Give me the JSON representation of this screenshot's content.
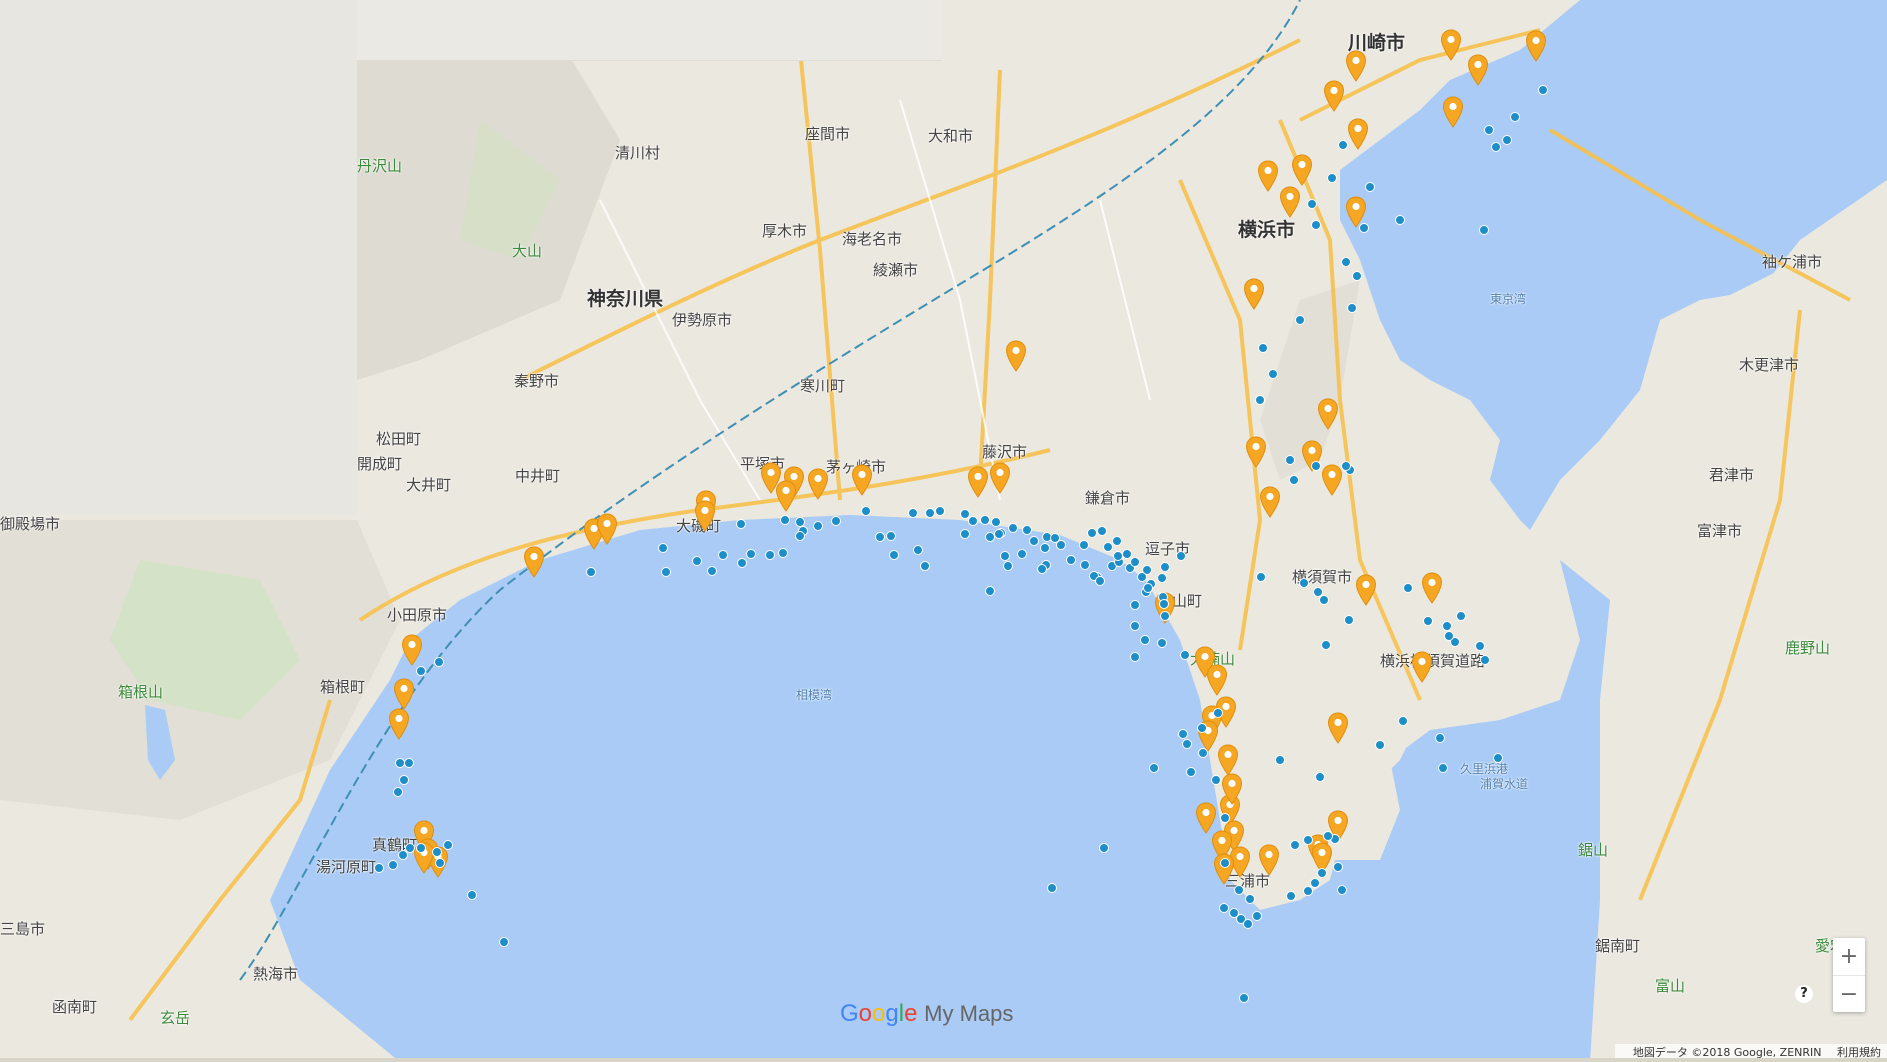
{
  "colors": {
    "land": "#ece9e2",
    "sea": "#a9cbf6",
    "highway": "#f7c14c",
    "marker": "#f5a623",
    "dot": "#1e8ec9"
  },
  "places": [
    {
      "text": "川崎市",
      "cls": "big"
    },
    {
      "text": "横浜市",
      "cls": "big"
    },
    {
      "text": "横須賀市",
      "cls": ""
    },
    {
      "text": "座間市",
      "cls": ""
    },
    {
      "text": "大和市",
      "cls": ""
    },
    {
      "text": "厚木市",
      "cls": ""
    },
    {
      "text": "海老名市",
      "cls": ""
    },
    {
      "text": "綾瀬市",
      "cls": ""
    },
    {
      "text": "清川村",
      "cls": ""
    },
    {
      "text": "丹沢山",
      "cls": "green"
    },
    {
      "text": "大山",
      "cls": "green"
    },
    {
      "text": "神奈川県",
      "cls": "big"
    },
    {
      "text": "伊勢原市",
      "cls": ""
    },
    {
      "text": "秦野市",
      "cls": ""
    },
    {
      "text": "寒川町",
      "cls": ""
    },
    {
      "text": "平塚市",
      "cls": ""
    },
    {
      "text": "茅ヶ崎市",
      "cls": ""
    },
    {
      "text": "藤沢市",
      "cls": ""
    },
    {
      "text": "鎌倉市",
      "cls": ""
    },
    {
      "text": "逗子市",
      "cls": ""
    },
    {
      "text": "葉山町",
      "cls": ""
    },
    {
      "text": "大楠山",
      "cls": "green"
    },
    {
      "text": "松田町",
      "cls": ""
    },
    {
      "text": "開成町",
      "cls": ""
    },
    {
      "text": "大井町",
      "cls": ""
    },
    {
      "text": "中井町",
      "cls": ""
    },
    {
      "text": "大磯町",
      "cls": ""
    },
    {
      "text": "小田原市",
      "cls": ""
    },
    {
      "text": "箱根山",
      "cls": "green"
    },
    {
      "text": "箱根町",
      "cls": ""
    },
    {
      "text": "御殿場市",
      "cls": ""
    },
    {
      "text": "湯河原町",
      "cls": ""
    },
    {
      "text": "真鶴町",
      "cls": ""
    },
    {
      "text": "熱海市",
      "cls": ""
    },
    {
      "text": "函南町",
      "cls": ""
    },
    {
      "text": "三島市",
      "cls": ""
    },
    {
      "text": "玄岳",
      "cls": "green"
    },
    {
      "text": "相模湾",
      "cls": "sea"
    },
    {
      "text": "東京湾",
      "cls": "sea"
    },
    {
      "text": "袖ケ浦市",
      "cls": ""
    },
    {
      "text": "木更津市",
      "cls": ""
    },
    {
      "text": "君津市",
      "cls": ""
    },
    {
      "text": "富津市",
      "cls": ""
    },
    {
      "text": "鹿野山",
      "cls": "green"
    },
    {
      "text": "鋸山",
      "cls": "green"
    },
    {
      "text": "鋸南町",
      "cls": ""
    },
    {
      "text": "富山",
      "cls": "green"
    },
    {
      "text": "愛宕山",
      "cls": "green"
    },
    {
      "text": "三浦市",
      "cls": ""
    },
    {
      "text": "横浜横須賀道路",
      "cls": ""
    },
    {
      "text": "久里浜港",
      "cls": "sea"
    },
    {
      "text": "浦賀水道",
      "cls": "sea"
    }
  ],
  "logo": {
    "g": "G",
    "o1": "o",
    "o2": "o",
    "g2": "g",
    "l": "l",
    "e": "e",
    "suffix": "My Maps"
  },
  "zoom": {
    "in": "+",
    "out": "−"
  },
  "help": "?",
  "attribution": {
    "data": "地図データ ©2018 Google, ZENRIN",
    "terms": "利用規約"
  }
}
